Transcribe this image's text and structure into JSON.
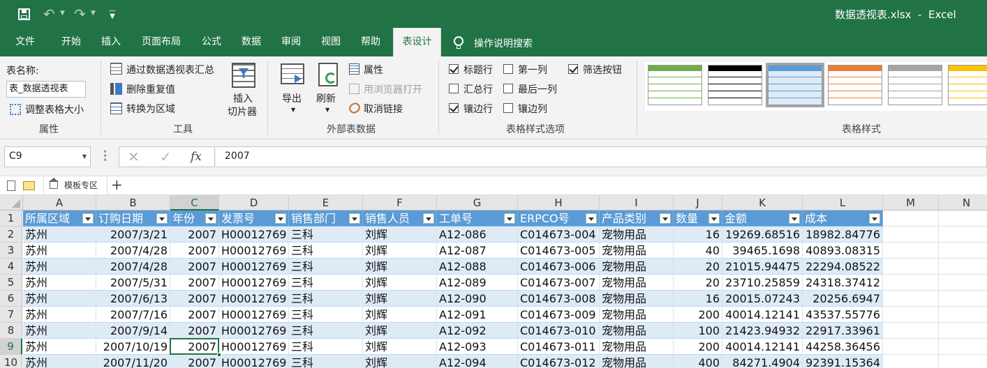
{
  "titlebar": {
    "title": "数据透视表.xlsx  -  Excel"
  },
  "tabs": [
    {
      "label": "文件"
    },
    {
      "label": "开始"
    },
    {
      "label": "插入"
    },
    {
      "label": "页面布局"
    },
    {
      "label": "公式"
    },
    {
      "label": "数据"
    },
    {
      "label": "审阅"
    },
    {
      "label": "视图"
    },
    {
      "label": "帮助"
    },
    {
      "label": "表设计"
    }
  ],
  "tellme": "操作说明搜索",
  "ribbon": {
    "props": {
      "label": "表名称:",
      "table_name": "表_数据透视表",
      "resize": "调整表格大小",
      "group": "属性"
    },
    "tools": {
      "summarize": "通过数据透视表汇总",
      "remove_dup": "删除重复值",
      "convert": "转换为区域",
      "slicer1": "插入",
      "slicer2": "切片器",
      "group": "工具"
    },
    "external": {
      "export": "导出",
      "refresh": "刷新",
      "properties": "属性",
      "open_browser": "用浏览器打开",
      "unlink": "取消链接",
      "group": "外部表数据"
    },
    "style_options": {
      "header_row": {
        "label": "标题行",
        "checked": true
      },
      "total_row": {
        "label": "汇总行",
        "checked": false
      },
      "banded_rows": {
        "label": "镶边行",
        "checked": true
      },
      "first_col": {
        "label": "第一列",
        "checked": false
      },
      "last_col": {
        "label": "最后一列",
        "checked": false
      },
      "banded_cols": {
        "label": "镶边列",
        "checked": false
      },
      "filter_btn": {
        "label": "筛选按钮",
        "checked": true
      },
      "group": "表格样式选项"
    },
    "styles": {
      "group": "表格样式",
      "swatches": [
        "#70ad47",
        "#000000",
        "#5b9bd5",
        "#ed7d31",
        "#a5a5a5",
        "#ffc000"
      ]
    }
  },
  "formula": {
    "namebox": "C9",
    "value": "2007",
    "fx": "fx"
  },
  "sheetbar": {
    "template_tab": "模板专区",
    "add": "+"
  },
  "columns": [
    "A",
    "B",
    "C",
    "D",
    "E",
    "F",
    "G",
    "H",
    "I",
    "J",
    "K",
    "L",
    "M",
    "N"
  ],
  "headers": [
    "所属区域",
    "订购日期",
    "年份",
    "发票号",
    "销售部门",
    "销售人员",
    "工单号",
    "ERPCO号",
    "产品类别",
    "数量",
    "金额",
    "成本"
  ],
  "rows": [
    [
      "苏州",
      "2007/3/21",
      "2007",
      "H00012769",
      "三科",
      "刘辉",
      "A12-086",
      "C014673-004",
      "宠物用品",
      "16",
      "19269.68516",
      "18982.84776"
    ],
    [
      "苏州",
      "2007/4/28",
      "2007",
      "H00012769",
      "三科",
      "刘辉",
      "A12-087",
      "C014673-005",
      "宠物用品",
      "40",
      "39465.1698",
      "40893.08315"
    ],
    [
      "苏州",
      "2007/4/28",
      "2007",
      "H00012769",
      "三科",
      "刘辉",
      "A12-088",
      "C014673-006",
      "宠物用品",
      "20",
      "21015.94475",
      "22294.08522"
    ],
    [
      "苏州",
      "2007/5/31",
      "2007",
      "H00012769",
      "三科",
      "刘辉",
      "A12-089",
      "C014673-007",
      "宠物用品",
      "20",
      "23710.25859",
      "24318.37412"
    ],
    [
      "苏州",
      "2007/6/13",
      "2007",
      "H00012769",
      "三科",
      "刘辉",
      "A12-090",
      "C014673-008",
      "宠物用品",
      "16",
      "20015.07243",
      "20256.6947"
    ],
    [
      "苏州",
      "2007/7/16",
      "2007",
      "H00012769",
      "三科",
      "刘辉",
      "A12-091",
      "C014673-009",
      "宠物用品",
      "200",
      "40014.12141",
      "43537.55776"
    ],
    [
      "苏州",
      "2007/9/14",
      "2007",
      "H00012769",
      "三科",
      "刘辉",
      "A12-092",
      "C014673-010",
      "宠物用品",
      "100",
      "21423.94932",
      "22917.33961"
    ],
    [
      "苏州",
      "2007/10/19",
      "2007",
      "H00012769",
      "三科",
      "刘辉",
      "A12-093",
      "C014673-011",
      "宠物用品",
      "200",
      "40014.12141",
      "44258.36456"
    ],
    [
      "苏州",
      "2007/11/20",
      "2007",
      "H00012769",
      "三科",
      "刘辉",
      "A12-094",
      "C014673-012",
      "宠物用品",
      "400",
      "84271.4904",
      "92391.15364"
    ]
  ],
  "selected_cell": "C9"
}
